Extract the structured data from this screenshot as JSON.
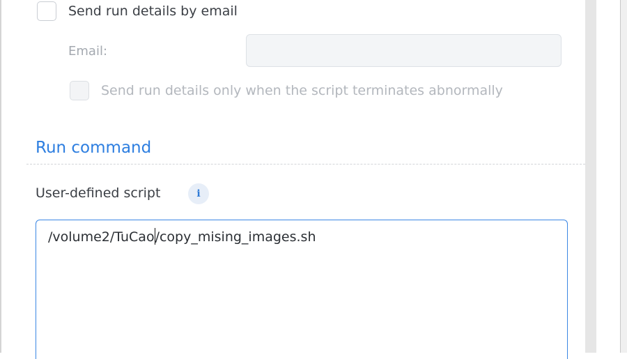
{
  "notification": {
    "send_email_label": "Send run details by email",
    "send_email_checked": false,
    "email_field_label": "Email:",
    "email_value": "",
    "email_placeholder": "",
    "abnormal_only_label": "Send run details only when the script terminates abnormally",
    "abnormal_only_checked": false,
    "abnormal_only_disabled": true
  },
  "run_command": {
    "section_title": "Run command",
    "script_label": "User-defined script",
    "info_icon": "info-icon",
    "info_glyph": "i",
    "script_before_caret": "/volume2/TuCao",
    "script_after_caret": "/copy_mising_images.sh"
  },
  "colors": {
    "accent": "#2d7ee0",
    "focus_border": "#3a86e4",
    "text": "#3b3f45",
    "muted_text": "#b3b7bd"
  }
}
